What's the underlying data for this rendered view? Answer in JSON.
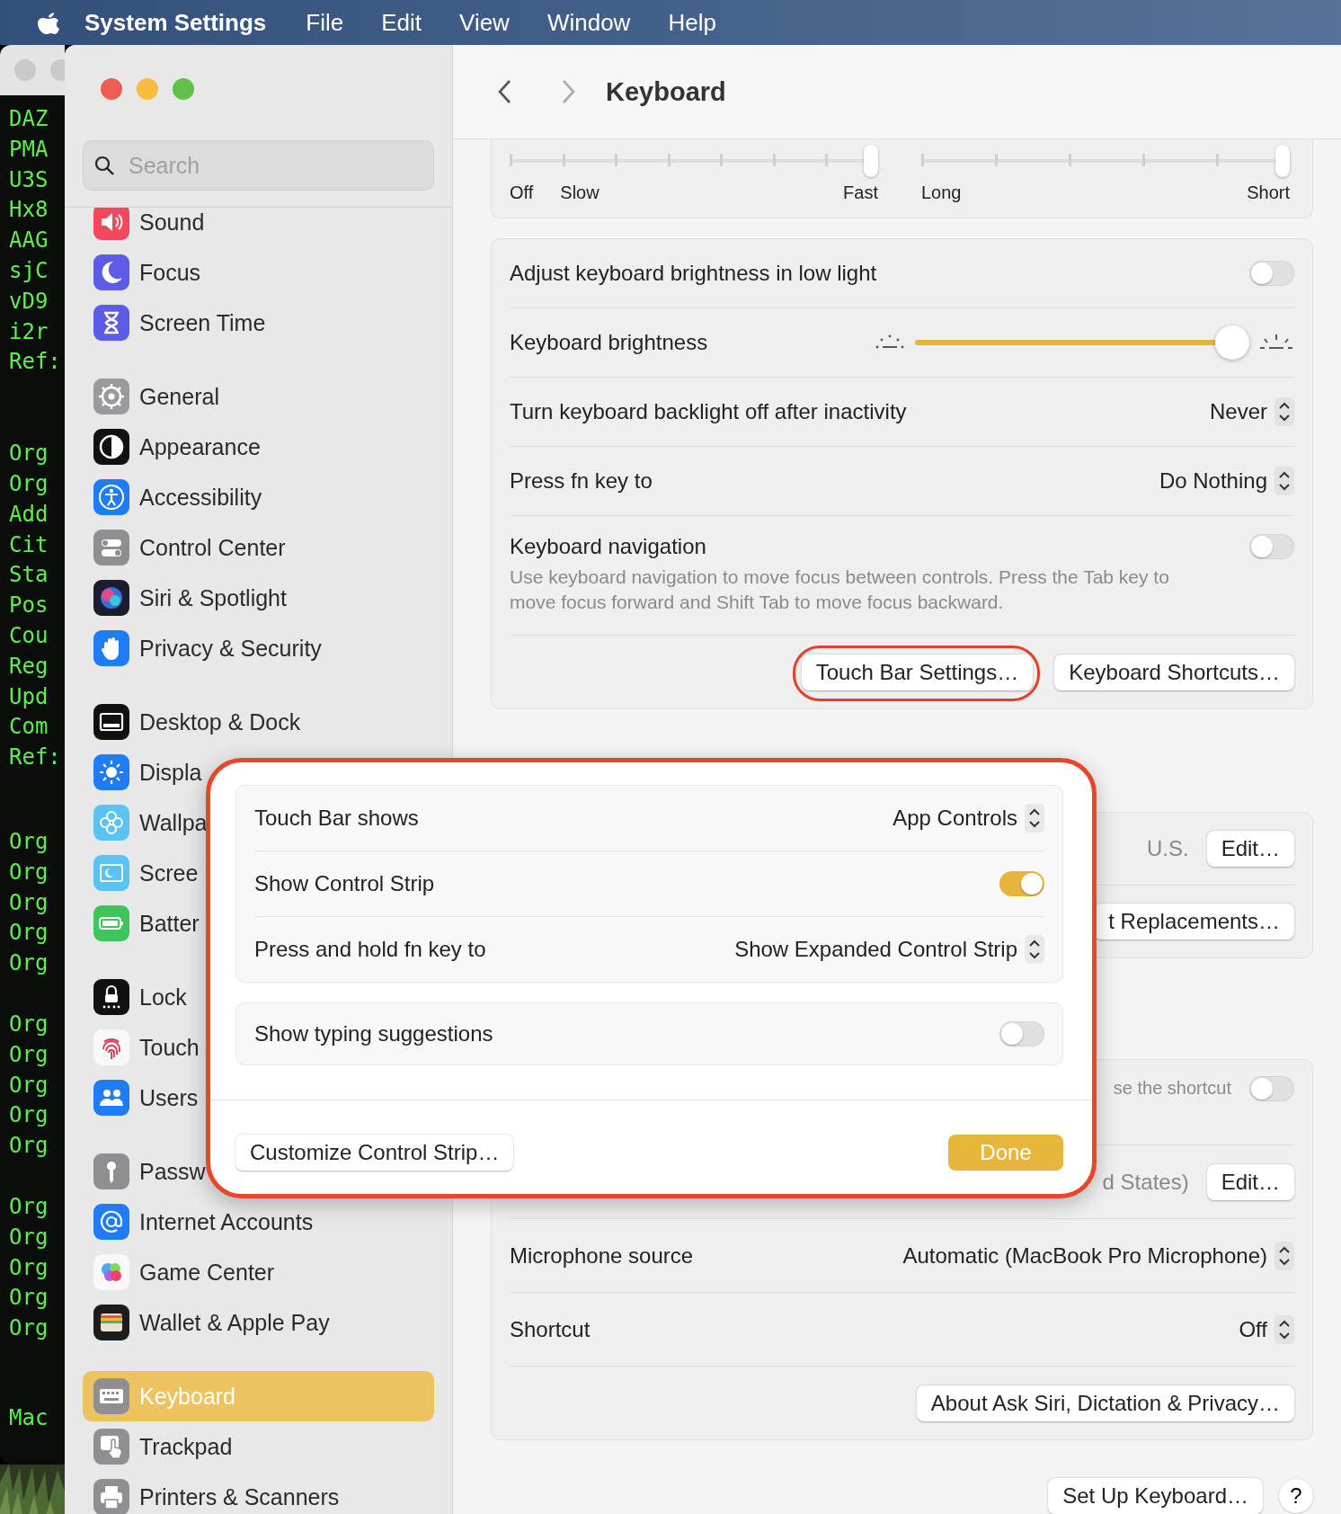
{
  "menu_bar": {
    "app_name": "System Settings",
    "menus": [
      "File",
      "Edit",
      "View",
      "Window",
      "Help"
    ]
  },
  "terminal": {
    "line_groups": [
      [
        "DAZ",
        "PMA",
        "U3S",
        "Hx8",
        "AAG",
        "sjC",
        "vD9",
        "i2r",
        "Ref:"
      ],
      [
        "Org",
        "Org",
        "Add",
        "Cit",
        "Sta",
        "Pos",
        "Cou",
        "Reg",
        "Upd",
        "Com",
        "Ref:"
      ],
      [
        "Org",
        "Org",
        "Org",
        "Org",
        "Org"
      ],
      [
        "Org",
        "Org",
        "Org",
        "Org",
        "Org"
      ],
      [
        "Org",
        "Org",
        "Org",
        "Org",
        "Org"
      ],
      [
        "Mac"
      ]
    ]
  },
  "sidebar": {
    "search": {
      "placeholder": "Search"
    },
    "groups": [
      [
        {
          "label": "Sound",
          "selected": false
        },
        {
          "label": "Focus",
          "selected": false
        },
        {
          "label": "Screen Time",
          "selected": false
        }
      ],
      [
        {
          "label": "General",
          "selected": false
        },
        {
          "label": "Appearance",
          "selected": false
        },
        {
          "label": "Accessibility",
          "selected": false
        },
        {
          "label": "Control Center",
          "selected": false
        },
        {
          "label": "Siri & Spotlight",
          "selected": false
        },
        {
          "label": "Privacy & Security",
          "selected": false
        }
      ],
      [
        {
          "label": "Desktop & Dock",
          "selected": false
        },
        {
          "label": "Displa",
          "selected": false
        },
        {
          "label": "Wallpa",
          "selected": false
        },
        {
          "label": "Scree",
          "selected": false
        },
        {
          "label": "Batter",
          "selected": false
        }
      ],
      [
        {
          "label": "Lock",
          "selected": false
        },
        {
          "label": "Touch",
          "selected": false
        },
        {
          "label": "Users",
          "selected": false
        }
      ],
      [
        {
          "label": "Passw",
          "selected": false
        },
        {
          "label": "Internet Accounts",
          "selected": false
        },
        {
          "label": "Game Center",
          "selected": false
        },
        {
          "label": "Wallet & Apple Pay",
          "selected": false
        }
      ],
      [
        {
          "label": "Keyboard",
          "selected": true
        },
        {
          "label": "Trackpad",
          "selected": false
        },
        {
          "label": "Printers & Scanners",
          "selected": false
        }
      ]
    ]
  },
  "header": {
    "title": "Keyboard"
  },
  "repeat_sliders": [
    {
      "level": 1,
      "labels": [
        "Off",
        "Slow",
        "Fast"
      ]
    },
    {
      "level": 1,
      "labels": [
        "Long",
        "Short"
      ]
    }
  ],
  "settings_cards": [
    {
      "rows": [
        {
          "kind": "toggle",
          "label": "Adjust keyboard brightness in low light",
          "on": false
        },
        {
          "kind": "slider",
          "label": "Keyboard brightness",
          "level": 0.95
        },
        {
          "kind": "popup",
          "label": "Turn keyboard backlight off after inactivity",
          "value": "Never"
        },
        {
          "kind": "popup",
          "label": "Press fn key to",
          "value": "Do Nothing"
        },
        {
          "kind": "toggle",
          "label": "Keyboard navigation",
          "description": "Use keyboard navigation to move focus between controls. Press the Tab key to move focus forward and Shift Tab to move focus backward.",
          "on": false
        },
        {
          "kind": "buttons",
          "buttons": [
            "Touch Bar Settings…",
            "Keyboard Shortcuts…"
          ]
        }
      ]
    },
    {
      "rows": [
        {
          "kind": "value_button",
          "value": "U.S.",
          "button": "Edit…"
        },
        {
          "kind": "button",
          "button": "t Replacements…"
        }
      ]
    },
    {
      "rows": [
        {
          "kind": "note_toggle",
          "note": "se the shortcut",
          "on": false
        },
        {
          "kind": "value_button",
          "value": "d States)",
          "button": "Edit…"
        },
        {
          "kind": "popup",
          "label": "Microphone source",
          "value": "Automatic (MacBook Pro Microphone)"
        },
        {
          "kind": "popup",
          "label": "Shortcut",
          "value": "Off"
        },
        {
          "kind": "button",
          "button": "About Ask Siri, Dictation & Privacy…"
        }
      ]
    }
  ],
  "footer": {
    "button": "Set Up Keyboard…",
    "help": "?"
  },
  "touch_bar_dialog": {
    "groups": [
      [
        {
          "kind": "popup",
          "label": "Touch Bar shows",
          "value": "App Controls"
        },
        {
          "kind": "toggle",
          "label": "Show Control Strip",
          "on": true
        },
        {
          "kind": "popup",
          "label": "Press and hold fn key to",
          "value": "Show Expanded Control Strip"
        }
      ],
      [
        {
          "kind": "toggle",
          "label": "Show typing suggestions",
          "on": false
        }
      ]
    ],
    "secondary_button": "Customize Control Strip…",
    "primary_button": "Done"
  }
}
